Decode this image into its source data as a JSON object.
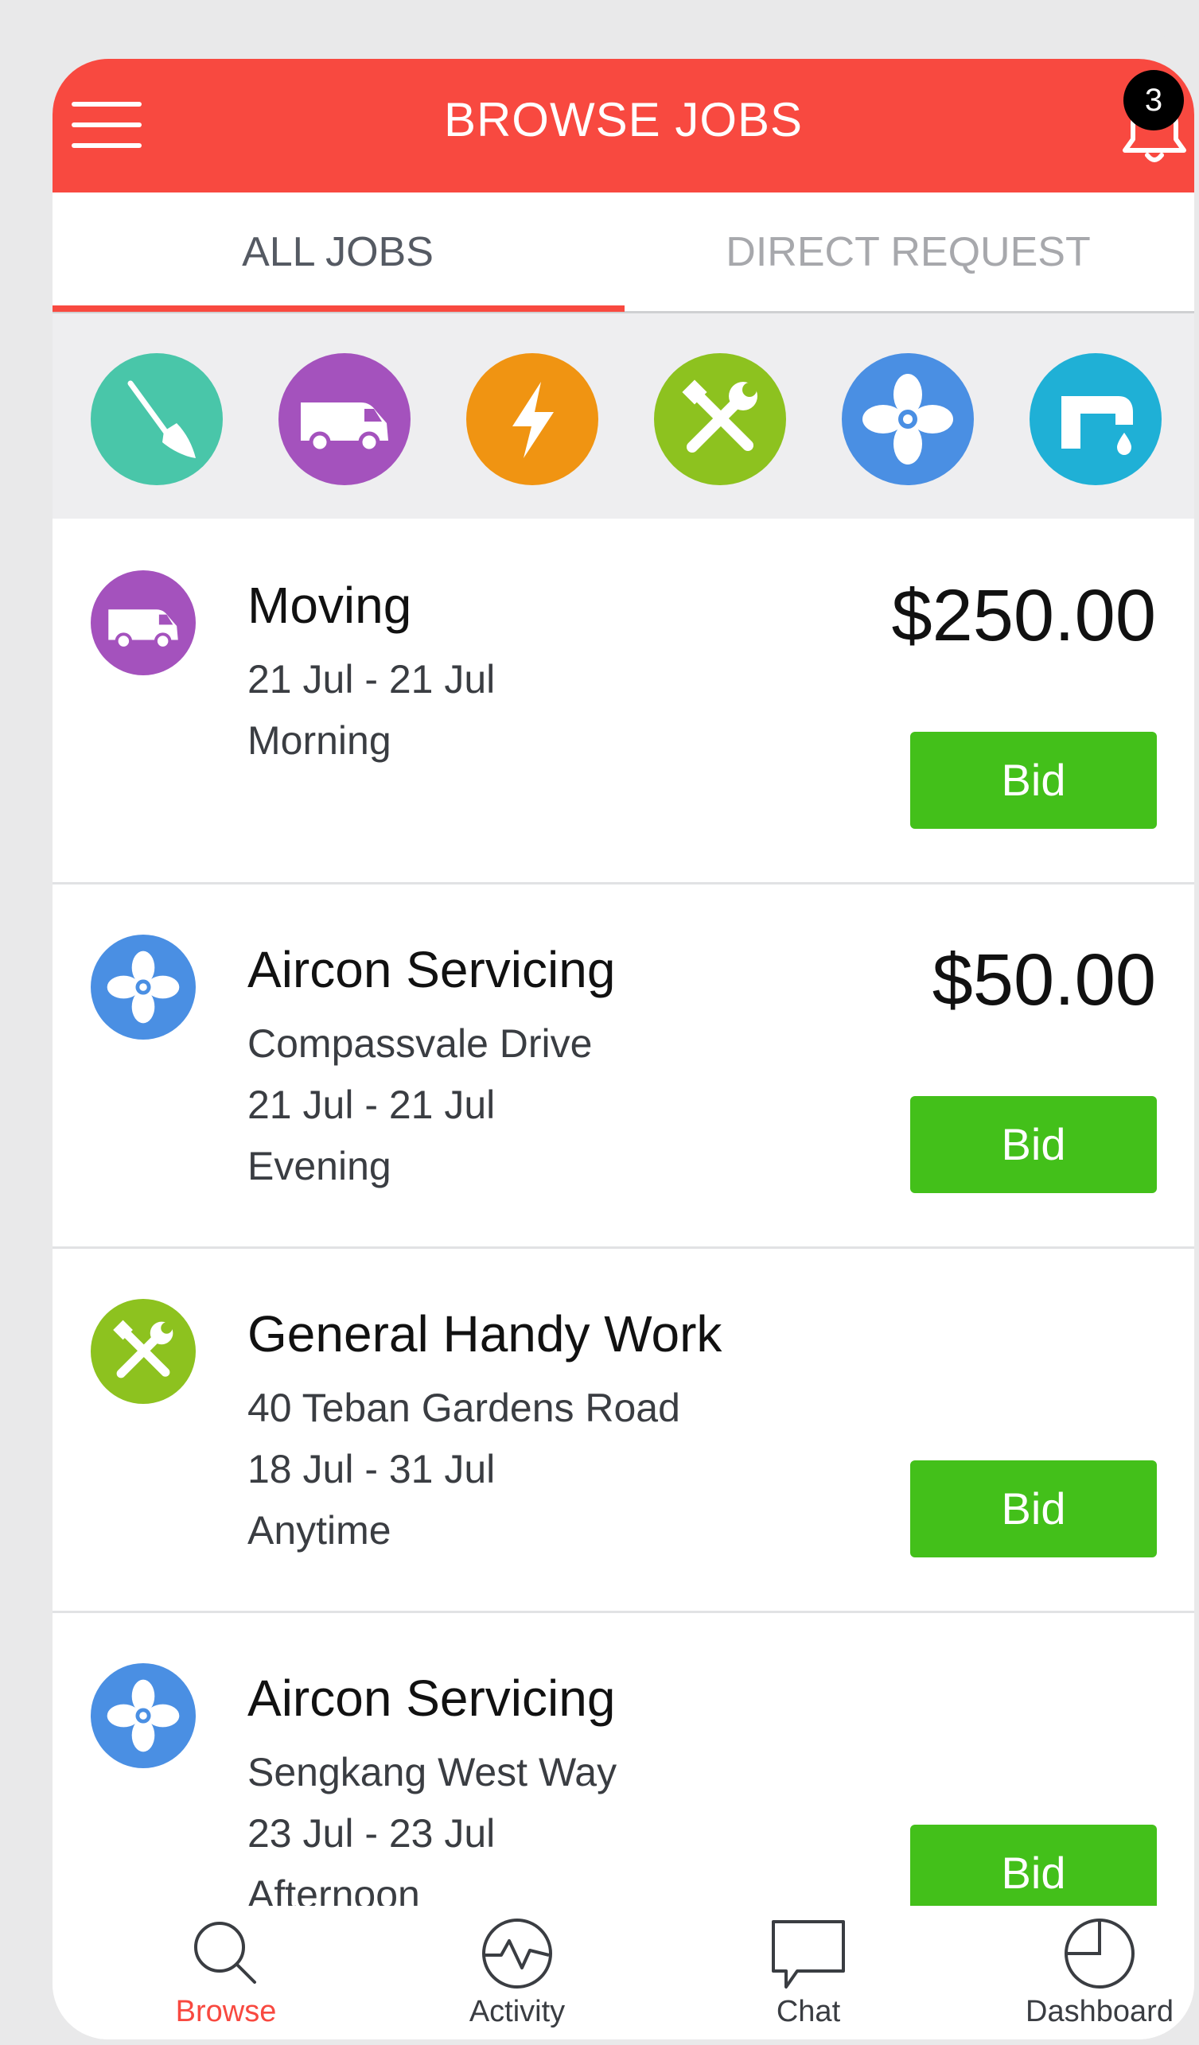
{
  "header": {
    "title": "BROWSE JOBS",
    "menu_icon": "hamburger-menu-icon",
    "bell_icon": "bell-icon",
    "notification_count": "3",
    "color": "#f84940"
  },
  "tabs": [
    {
      "label": "ALL JOBS",
      "active": true
    },
    {
      "label": "DIRECT REQUEST",
      "active": false
    }
  ],
  "categories": [
    {
      "icon": "broom-icon",
      "color": "#49c6a9"
    },
    {
      "icon": "van-icon",
      "color": "#a452bd"
    },
    {
      "icon": "lightning-icon",
      "color": "#f09412"
    },
    {
      "icon": "tools-icon",
      "color": "#8dc21f"
    },
    {
      "icon": "fan-icon",
      "color": "#4a8fe3"
    },
    {
      "icon": "faucet-icon",
      "color": "#1fb0d6"
    }
  ],
  "jobs": [
    {
      "icon": "van-icon",
      "title": "Moving",
      "lines": [
        "21 Jul - 21 Jul",
        "Morning"
      ],
      "price": "$250.00",
      "bid_label": "Bid"
    },
    {
      "icon": "fan-icon",
      "title": "Aircon Servicing",
      "lines": [
        "Compassvale Drive",
        "21 Jul - 21 Jul",
        "Evening"
      ],
      "price": "$50.00",
      "bid_label": "Bid"
    },
    {
      "icon": "tools-icon",
      "title": "General Handy Work",
      "lines": [
        "40 Teban Gardens Road",
        "18 Jul - 31 Jul",
        "Anytime"
      ],
      "price": "",
      "bid_label": "Bid"
    },
    {
      "icon": "fan-icon",
      "title": "Aircon Servicing",
      "lines": [
        "Sengkang West Way",
        "23 Jul - 23 Jul",
        "Afternoon"
      ],
      "price": "",
      "bid_label": "Bid"
    }
  ],
  "bottom_nav": [
    {
      "label": "Browse",
      "icon": "search-icon",
      "active": true
    },
    {
      "label": "Activity",
      "icon": "activity-icon",
      "active": false
    },
    {
      "label": "Chat",
      "icon": "chat-bubble-icon",
      "active": false
    },
    {
      "label": "Dashboard",
      "icon": "pie-chart-icon",
      "active": false
    }
  ],
  "colors": {
    "accent": "#f84940",
    "bid_button": "#43c01a",
    "inactive_tab_text": "#a7a8ac"
  }
}
